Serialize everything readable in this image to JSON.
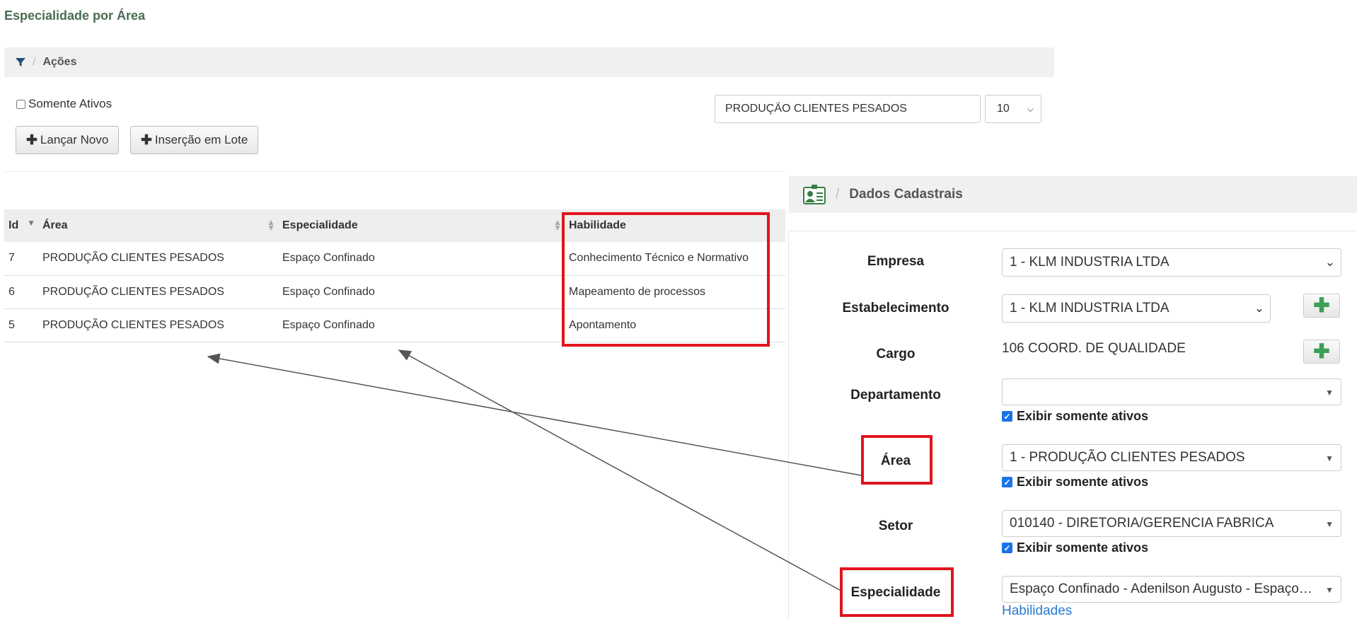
{
  "page_title": "Especialidade por Área",
  "breadcrumb": {
    "sep": "/",
    "label": "Ações"
  },
  "filter": {
    "somente_ativos_label": "Somente Ativos",
    "search_value": "PRODUÇÃO CLIENTES PESADOS",
    "page_size": "10"
  },
  "toolbar": {
    "lancar_novo": "Lançar Novo",
    "insercao_lote": "Inserção em Lote",
    "plus": "✚"
  },
  "table": {
    "headers": {
      "id": "Id",
      "area": "Área",
      "especialidade": "Especialidade",
      "habilidade": "Habilidade"
    },
    "rows": [
      {
        "id": "7",
        "area": "PRODUÇÃO CLIENTES PESADOS",
        "especialidade": "Espaço Confinado",
        "habilidade": "Conhecimento Técnico e Normativo"
      },
      {
        "id": "6",
        "area": "PRODUÇÃO CLIENTES PESADOS",
        "especialidade": "Espaço Confinado",
        "habilidade": "Mapeamento de processos"
      },
      {
        "id": "5",
        "area": "PRODUÇÃO CLIENTES PESADOS",
        "especialidade": "Espaço Confinado",
        "habilidade": "Apontamento"
      }
    ]
  },
  "panel": {
    "sep": "/",
    "title": "Dados Cadastrais",
    "fields": {
      "empresa": {
        "label": "Empresa",
        "value": "1 - KLM INDUSTRIA LTDA"
      },
      "estabelecimento": {
        "label": "Estabelecimento",
        "value": "1 - KLM INDUSTRIA LTDA"
      },
      "cargo": {
        "label": "Cargo",
        "value": "106 COORD. DE QUALIDADE"
      },
      "departamento": {
        "label": "Departamento",
        "value": ""
      },
      "area": {
        "label": "Área",
        "value": "1 - PRODUÇÃO CLIENTES PESADOS"
      },
      "setor": {
        "label": "Setor",
        "value": "010140 - DIRETORIA/GERENCIA FABRICA"
      },
      "especialidade": {
        "label": "Especialidade",
        "value": "Espaço Confinado - Adenilson Augusto - Espaço…"
      }
    },
    "exibir_ativos_label": "Exibir somente ativos",
    "habilidades_link": "Habilidades"
  },
  "colors": {
    "accent_red": "#e0141e",
    "title_green": "#4a6b55",
    "link_blue": "#2a7bd3",
    "plus_green": "#3aa055"
  },
  "icons": {
    "filter": "filter-icon",
    "contact_card": "contact-card-icon",
    "plus": "plus-icon"
  }
}
